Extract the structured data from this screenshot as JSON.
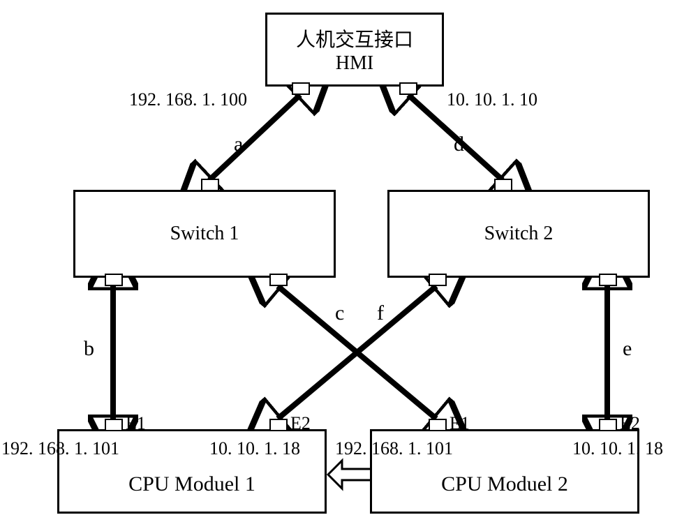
{
  "nodes": {
    "hmi": {
      "line1": "人机交互接口",
      "line2": "HMI"
    },
    "switch1": "Switch 1",
    "switch2": "Switch 2",
    "cpu1": "CPU Moduel 1",
    "cpu2": "CPU Moduel 2"
  },
  "ips": {
    "hmi_left": "192. 168. 1. 100",
    "hmi_right": "10. 10. 1. 10",
    "cpu1_e1": "192. 168. 1. 101",
    "cpu1_e2": "10. 10. 1. 18",
    "cpu2_e1": "192. 168. 1. 101",
    "cpu2_e2": "10. 10. 1. 18"
  },
  "ports": {
    "e1": "E1",
    "e2": "E2"
  },
  "edges": {
    "a": "a",
    "b": "b",
    "c": "c",
    "d": "d",
    "e": "e",
    "f": "f"
  }
}
